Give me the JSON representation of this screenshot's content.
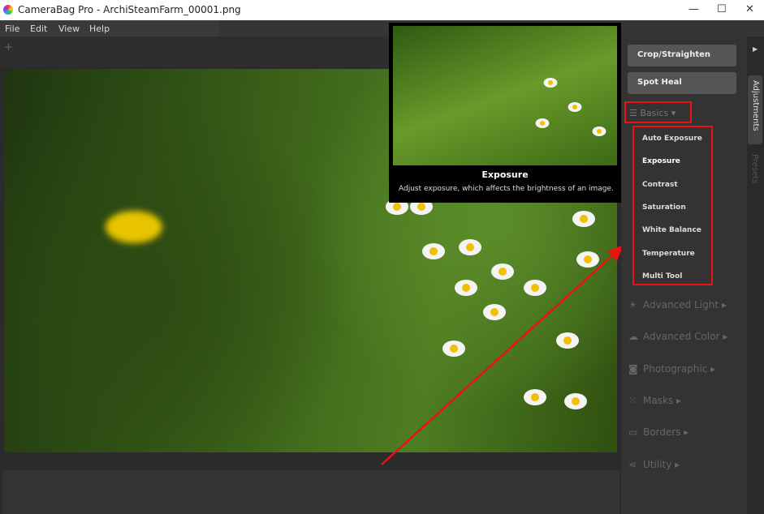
{
  "window": {
    "title": "CameraBag Pro - ArchiSteamFarm_00001.png",
    "min": "—",
    "max": "☐",
    "close": "✕"
  },
  "menu": [
    "File",
    "Edit",
    "View",
    "Help"
  ],
  "toolbar": {
    "add": "+"
  },
  "tooltip": {
    "title": "Exposure",
    "description": "Adjust exposure, which affects the brightness of an image."
  },
  "panel": {
    "buttons": [
      "Crop/Straighten",
      "Spot Heal"
    ],
    "basics": {
      "label": "Basics",
      "items": [
        "Auto Exposure",
        "Exposure",
        "Contrast",
        "Saturation",
        "White Balance",
        "Temperature",
        "Multi Tool"
      ]
    },
    "sections": [
      {
        "label": "Advanced Light",
        "icon": "☀"
      },
      {
        "label": "Advanced Color",
        "icon": "☁"
      },
      {
        "label": "Photographic",
        "icon": "◙"
      },
      {
        "label": "Masks",
        "icon": "⁙"
      },
      {
        "label": "Borders",
        "icon": "▭"
      },
      {
        "label": "Utility",
        "icon": "⋖"
      }
    ]
  },
  "side_tabs": {
    "arrow": "▶",
    "adjustments": "Adjustments",
    "presets": "Presets"
  },
  "annotation_color": "#e11111"
}
